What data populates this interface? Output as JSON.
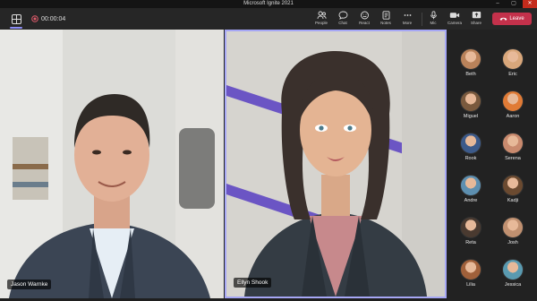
{
  "window": {
    "title": "Microsoft Ignite 2021"
  },
  "toolbar": {
    "timer": "00:00:04",
    "buttons": [
      {
        "id": "people",
        "label": "People"
      },
      {
        "id": "chat",
        "label": "Chat"
      },
      {
        "id": "react",
        "label": "React"
      },
      {
        "id": "notes",
        "label": "Notes"
      },
      {
        "id": "more",
        "label": "More"
      },
      {
        "id": "mic",
        "label": "Mic"
      },
      {
        "id": "camera",
        "label": "Camera"
      },
      {
        "id": "share",
        "label": "Share"
      }
    ],
    "leave_label": "Leave",
    "colors": {
      "accent": "#8b8cf5",
      "leave": "#c4314b"
    }
  },
  "stage": {
    "tiles": [
      {
        "name": "Jason Warnke"
      },
      {
        "name": "Ellyn Shook"
      }
    ]
  },
  "roster": {
    "participants": [
      {
        "name": "Beth",
        "color": "#b9825a"
      },
      {
        "name": "Eric",
        "color": "#d9a77b"
      },
      {
        "name": "Miguel",
        "color": "#7a5a3e"
      },
      {
        "name": "Aaron",
        "color": "#e07b36"
      },
      {
        "name": "Rook",
        "color": "#3c5a8a"
      },
      {
        "name": "Serena",
        "color": "#c98a6e"
      },
      {
        "name": "Andre",
        "color": "#5d8fb0"
      },
      {
        "name": "Kadji",
        "color": "#6b4a30"
      },
      {
        "name": "Reta",
        "color": "#4a3a30"
      },
      {
        "name": "Josh",
        "color": "#c09070"
      },
      {
        "name": "Lilia",
        "color": "#a0603a"
      },
      {
        "name": "Jessica",
        "color": "#5a9ab0"
      }
    ]
  }
}
